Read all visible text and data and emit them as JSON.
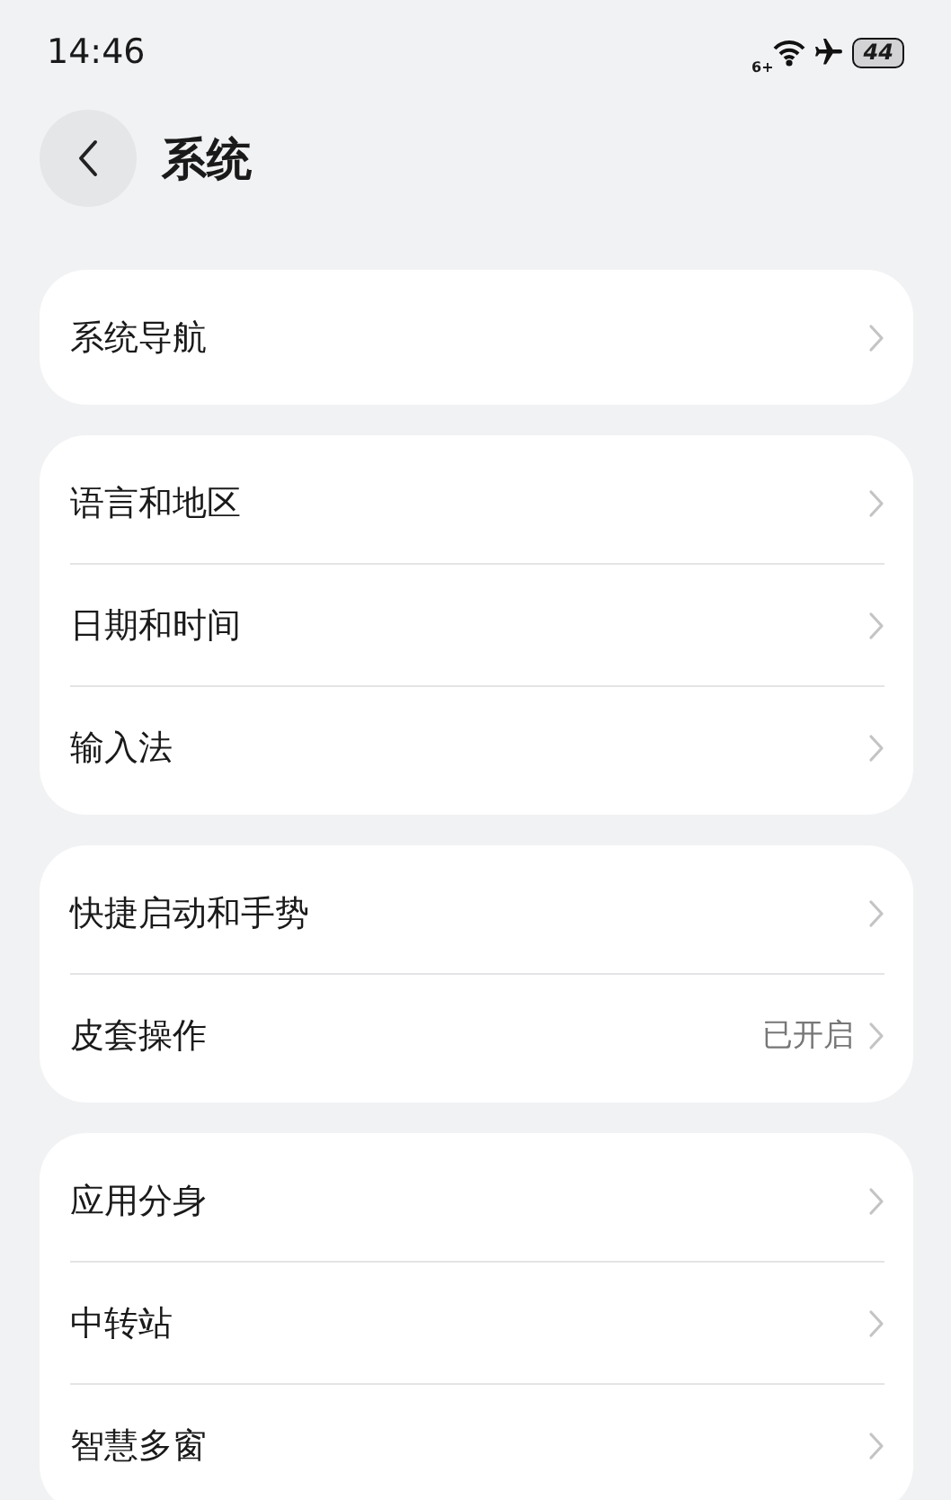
{
  "status_bar": {
    "time": "14:46",
    "wifi_label": "6+",
    "battery": "44"
  },
  "header": {
    "title": "系统"
  },
  "groups": [
    {
      "items": [
        {
          "label": "系统导航"
        }
      ]
    },
    {
      "items": [
        {
          "label": "语言和地区"
        },
        {
          "label": "日期和时间"
        },
        {
          "label": "输入法"
        }
      ]
    },
    {
      "items": [
        {
          "label": "快捷启动和手势"
        },
        {
          "label": "皮套操作",
          "value": "已开启"
        }
      ]
    },
    {
      "items": [
        {
          "label": "应用分身"
        },
        {
          "label": "中转站"
        },
        {
          "label": "智慧多窗"
        }
      ]
    }
  ]
}
